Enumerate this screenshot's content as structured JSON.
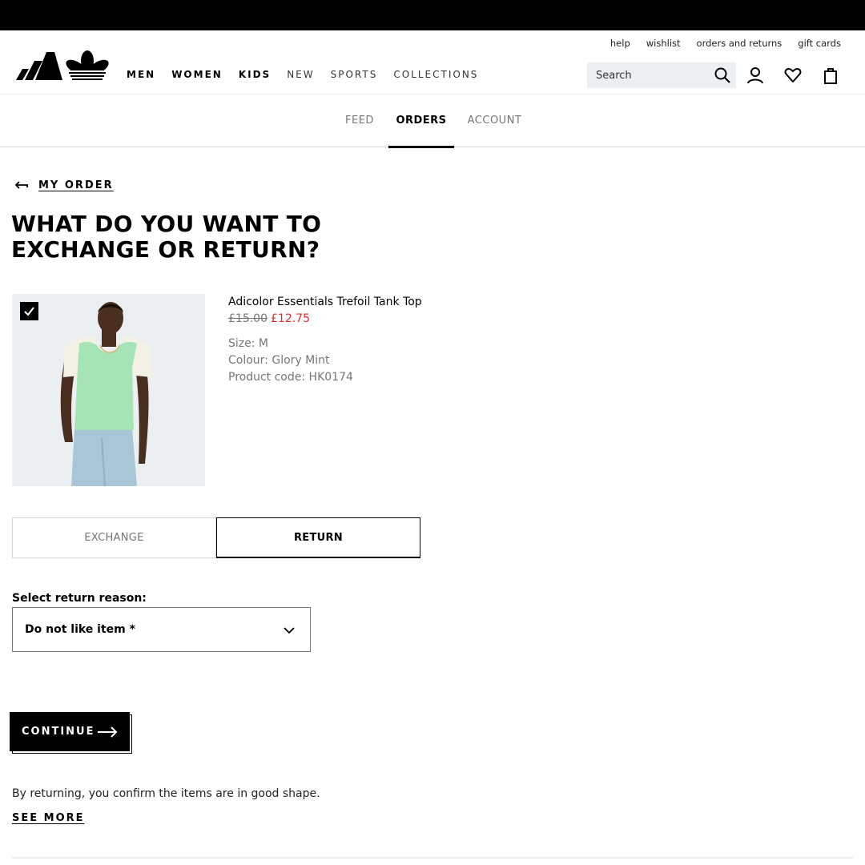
{
  "utility_links": [
    "help",
    "wishlist",
    "orders and returns",
    "gift cards"
  ],
  "nav": {
    "items": [
      {
        "label": "MEN",
        "weight": "bold"
      },
      {
        "label": "WOMEN",
        "weight": "bold"
      },
      {
        "label": "KIDS",
        "weight": "bold"
      },
      {
        "label": "NEW",
        "weight": "light"
      },
      {
        "label": "SPORTS",
        "weight": "light"
      },
      {
        "label": "COLLECTIONS",
        "weight": "light"
      }
    ],
    "search_placeholder": "Search",
    "icons": [
      "search-icon",
      "account-icon",
      "wishlist-heart-icon",
      "shopping-bag-icon"
    ]
  },
  "account_tabs": [
    {
      "label": "FEED",
      "active": false
    },
    {
      "label": "ORDERS",
      "active": true
    },
    {
      "label": "ACCOUNT",
      "active": false
    }
  ],
  "back_link": "MY ORDER",
  "title": "WHAT DO YOU WANT TO EXCHANGE OR RETURN?",
  "product": {
    "name": "Adicolor Essentials Trefoil Tank Top",
    "price_original": "£15.00",
    "price_sale": "£12.75",
    "size_label": "Size:",
    "size": "M",
    "colour_label": "Colour:",
    "colour": "Glory Mint",
    "code_label": "Product code:",
    "code": "HK0174",
    "selected": true
  },
  "options": {
    "exchange": "EXCHANGE",
    "return": "RETURN",
    "selected": "return"
  },
  "reason": {
    "label": "Select return reason:",
    "value": "Do not like item *"
  },
  "continue_label": "CONTINUE",
  "note": "By returning, you confirm the items are in good shape.",
  "see_more": "SEE MORE",
  "colors": {
    "sale_red": "#e32b2b",
    "muted_grey": "#767677",
    "image_bg": "#eceff1",
    "tank_mint": "#a7e4b5"
  }
}
